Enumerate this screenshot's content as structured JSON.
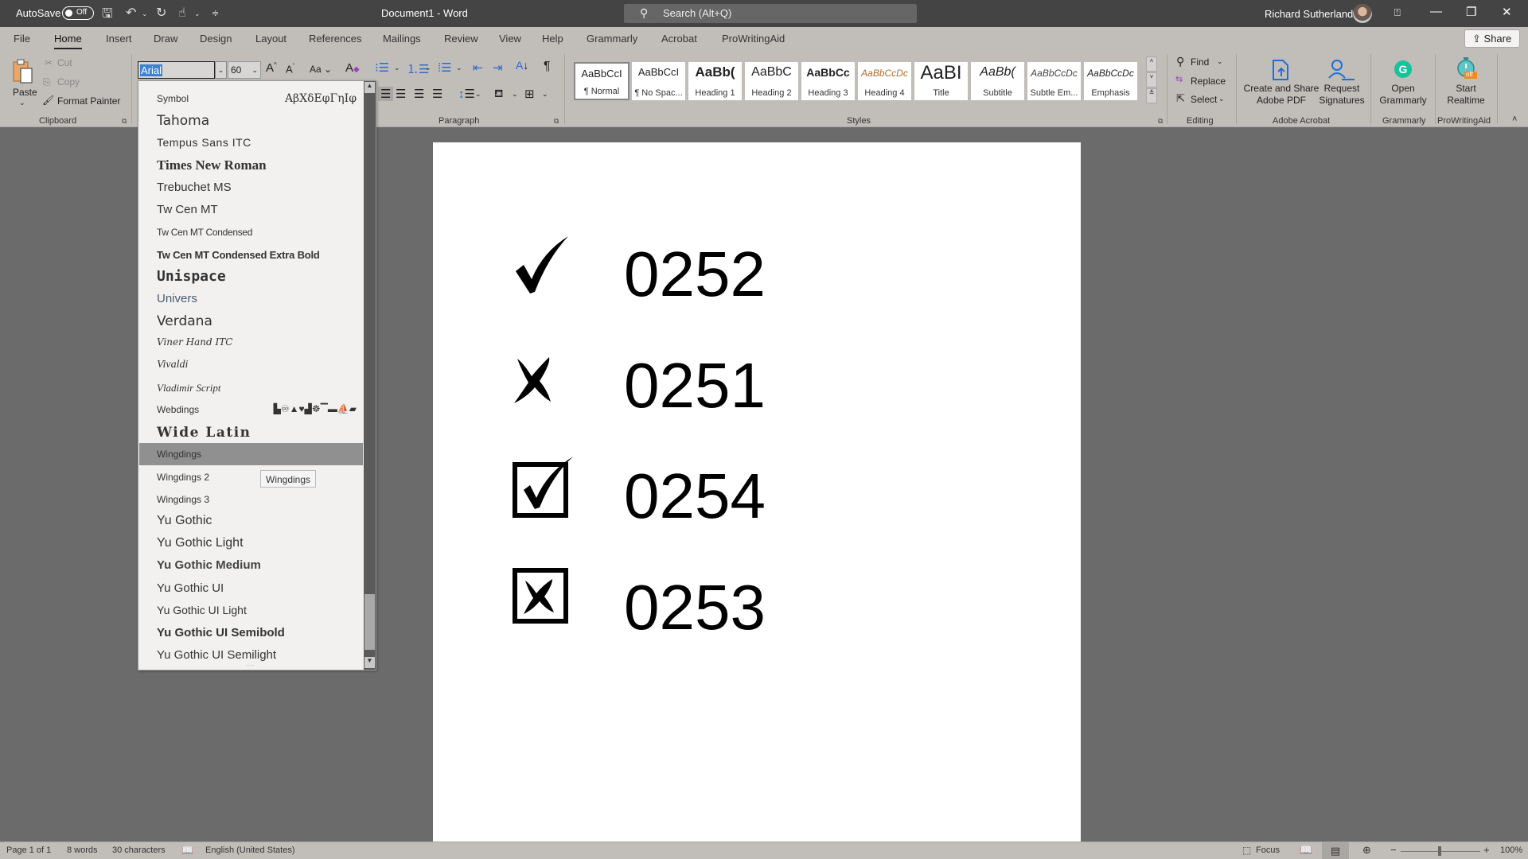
{
  "titlebar": {
    "autosave_label": "AutoSave",
    "autosave_state": "Off",
    "document_title": "Document1  -  Word",
    "search_placeholder": "Search (Alt+Q)",
    "user_name": "Richard Sutherland"
  },
  "menu_tabs": [
    {
      "label": "File"
    },
    {
      "label": "Home",
      "active": true
    },
    {
      "label": "Insert"
    },
    {
      "label": "Draw"
    },
    {
      "label": "Design"
    },
    {
      "label": "Layout"
    },
    {
      "label": "References"
    },
    {
      "label": "Mailings"
    },
    {
      "label": "Review"
    },
    {
      "label": "View"
    },
    {
      "label": "Help"
    },
    {
      "label": "Grammarly"
    },
    {
      "label": "Acrobat"
    },
    {
      "label": "ProWritingAid"
    }
  ],
  "share_label": "Share",
  "ribbon": {
    "clipboard": {
      "paste": "Paste",
      "cut": "Cut",
      "copy": "Copy",
      "format_painter": "Format Painter",
      "group_label": "Clipboard"
    },
    "font": {
      "font_name": "Arial",
      "font_size": "60",
      "change_case": "Aa"
    },
    "paragraph": {
      "group_label": "Paragraph"
    },
    "styles": {
      "group_label": "Styles",
      "items": [
        {
          "sample": "AaBbCcI",
          "name": "¶ Normal",
          "selected": true
        },
        {
          "sample": "AaBbCcI",
          "name": "¶ No Spac..."
        },
        {
          "sample": "AaBb(",
          "name": "Heading 1"
        },
        {
          "sample": "AaBbC",
          "name": "Heading 2"
        },
        {
          "sample": "AaBbCc",
          "name": "Heading 3"
        },
        {
          "sample": "AaBbCcDc",
          "name": "Heading 4"
        },
        {
          "sample": "AaBI",
          "name": "Title"
        },
        {
          "sample": "AaBb(",
          "name": "Subtitle"
        },
        {
          "sample": "AaBbCcDc",
          "name": "Subtle Em..."
        },
        {
          "sample": "AaBbCcDc",
          "name": "Emphasis"
        }
      ]
    },
    "editing": {
      "find": "Find",
      "replace": "Replace",
      "select": "Select",
      "group_label": "Editing"
    },
    "acrobat": {
      "create_share_line1": "Create and Share",
      "create_share_line2": "Adobe PDF",
      "request_line1": "Request",
      "request_line2": "Signatures",
      "group_label": "Adobe Acrobat"
    },
    "grammarly": {
      "open_line1": "Open",
      "open_line2": "Grammarly",
      "group_label": "Grammarly"
    },
    "prowritingaid": {
      "start_line1": "Start",
      "start_line2": "Realtime",
      "badge": "off",
      "group_label": "ProWritingAid"
    }
  },
  "font_dropdown": {
    "items": [
      {
        "name": "Symbol",
        "preview": "ΑβΧδΕφΓηΙφ"
      },
      {
        "name": "Tahoma"
      },
      {
        "name": "Tempus Sans ITC"
      },
      {
        "name": "Times New Roman"
      },
      {
        "name": "Trebuchet MS"
      },
      {
        "name": "Tw Cen MT"
      },
      {
        "name": "Tw Cen MT Condensed"
      },
      {
        "name": "Tw Cen MT Condensed Extra Bold"
      },
      {
        "name": "Unispace"
      },
      {
        "name": "Univers"
      },
      {
        "name": "Verdana"
      },
      {
        "name": "Viner Hand ITC"
      },
      {
        "name": "Vivaldi"
      },
      {
        "name": "Vladimir Script"
      },
      {
        "name": "Webdings",
        "preview": "▙♾▲♥▟☸▔▬⛵▰"
      },
      {
        "name": "Wide Latin"
      },
      {
        "name": "Wingdings",
        "highlighted": true
      },
      {
        "name": "Wingdings 2"
      },
      {
        "name": "Wingdings 3"
      },
      {
        "name": "Yu Gothic"
      },
      {
        "name": "Yu Gothic Light"
      },
      {
        "name": "Yu Gothic Medium"
      },
      {
        "name": "Yu Gothic UI"
      },
      {
        "name": "Yu Gothic UI Light"
      },
      {
        "name": "Yu Gothic UI Semibold"
      },
      {
        "name": "Yu Gothic UI Semilight"
      }
    ],
    "tooltip": "Wingdings"
  },
  "document": {
    "lines": [
      {
        "symbol": "check-mark",
        "code": "0252"
      },
      {
        "symbol": "x-mark",
        "code": "0251"
      },
      {
        "symbol": "checked-box",
        "code": "0254"
      },
      {
        "symbol": "x-box",
        "code": "0253"
      }
    ]
  },
  "statusbar": {
    "page": "Page 1 of 1",
    "words": "8 words",
    "characters": "30 characters",
    "language": "English (United States)",
    "focus": "Focus",
    "zoom": "100%",
    "zoom_minus": "−",
    "zoom_plus": "+"
  }
}
